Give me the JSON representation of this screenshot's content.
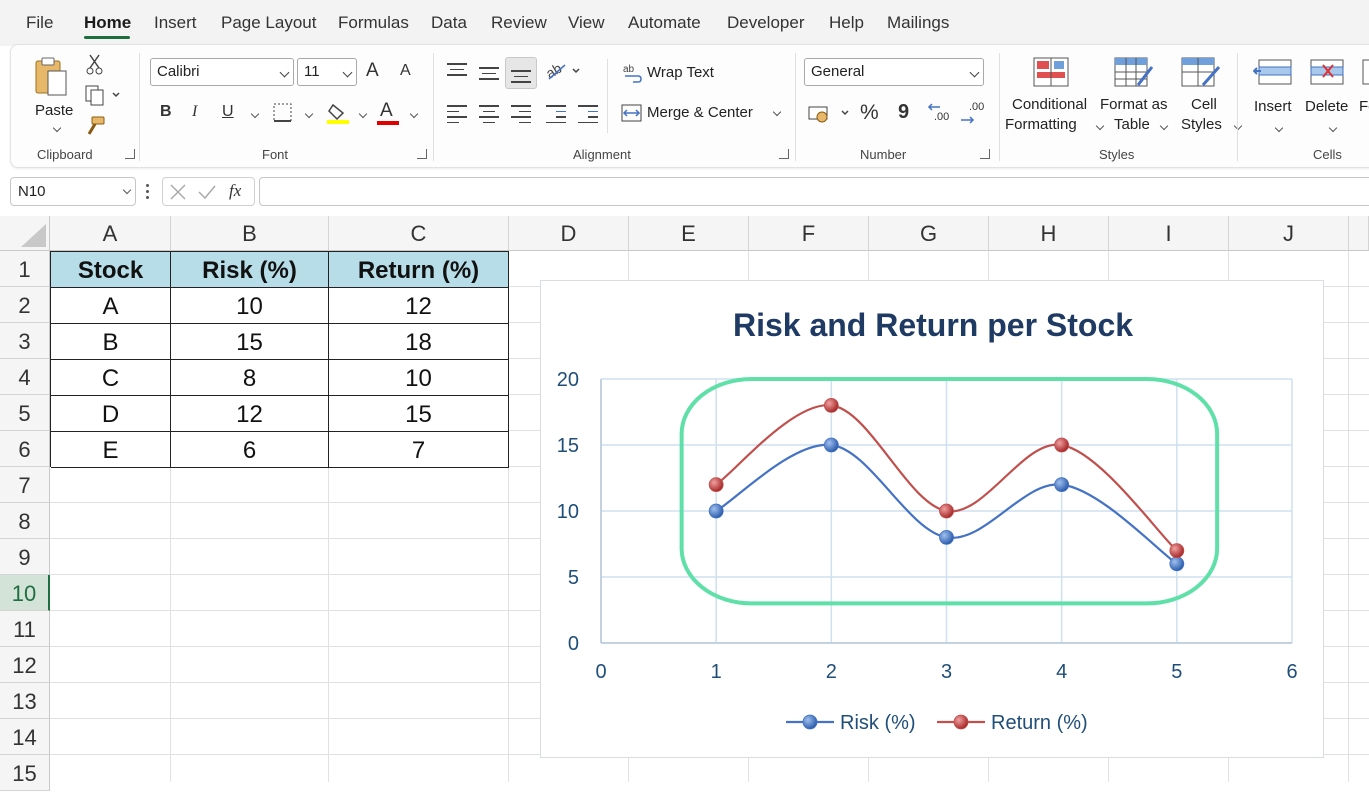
{
  "menu": [
    "File",
    "Home",
    "Insert",
    "Page Layout",
    "Formulas",
    "Data",
    "Review",
    "View",
    "Automate",
    "Developer",
    "Help",
    "Mailings"
  ],
  "ribbon": {
    "clipboard": {
      "paste": "Paste",
      "label": "Clipboard"
    },
    "font": {
      "name": "Calibri",
      "size": "11",
      "grow": "A",
      "shrink": "A",
      "bold": "B",
      "italic": "I",
      "underline": "U",
      "label": "Font",
      "font_color_letter": "A"
    },
    "alignment": {
      "wrap_text": "Wrap Text",
      "merge_center": "Merge & Center",
      "label": "Alignment"
    },
    "number": {
      "format": "General",
      "percent": "%",
      "comma": "9",
      "label": "Number",
      "inc_decimal": ".00",
      "dec_decimal": ".00"
    },
    "styles": {
      "conditional_1": "Conditional",
      "conditional_2": "Formatting",
      "format_table_1": "Format as",
      "format_table_2": "Table",
      "cell_styles_1": "Cell",
      "cell_styles_2": "Styles",
      "label": "Styles"
    },
    "cells": {
      "insert": "Insert",
      "delete": "Delete",
      "format": "Fo",
      "label": "Cells"
    }
  },
  "formula_bar": {
    "name_box": "N10",
    "fx": "fx",
    "value": ""
  },
  "columns": [
    "A",
    "B",
    "C",
    "D",
    "E",
    "F",
    "G",
    "H",
    "I",
    "J"
  ],
  "rows": [
    "1",
    "2",
    "3",
    "4",
    "5",
    "6",
    "7",
    "8",
    "9",
    "10",
    "11",
    "12",
    "13",
    "14",
    "15"
  ],
  "selected_row": "10",
  "table": {
    "headers": [
      "Stock",
      "Risk (%)",
      "Return (%)"
    ],
    "rows": [
      [
        "A",
        "10",
        "12"
      ],
      [
        "B",
        "15",
        "18"
      ],
      [
        "C",
        "8",
        "10"
      ],
      [
        "D",
        "12",
        "15"
      ],
      [
        "E",
        "6",
        "7"
      ]
    ]
  },
  "chart_data": {
    "type": "line",
    "title": "Risk and Return per Stock",
    "x": [
      1,
      2,
      3,
      4,
      5
    ],
    "xlim": [
      0,
      6
    ],
    "ylim": [
      0,
      20
    ],
    "xticks": [
      "0",
      "1",
      "2",
      "3",
      "4",
      "5",
      "6"
    ],
    "yticks": [
      "0",
      "5",
      "10",
      "15",
      "20"
    ],
    "smooth": true,
    "grid": true,
    "legend_position": "bottom",
    "series": [
      {
        "name": "Risk (%)",
        "values": [
          10,
          15,
          8,
          12,
          6
        ],
        "color": "#4472c4"
      },
      {
        "name": "Return (%)",
        "values": [
          12,
          18,
          10,
          15,
          7
        ],
        "color": "#c0504d"
      }
    ],
    "highlight_color": "#5fe0a8"
  }
}
